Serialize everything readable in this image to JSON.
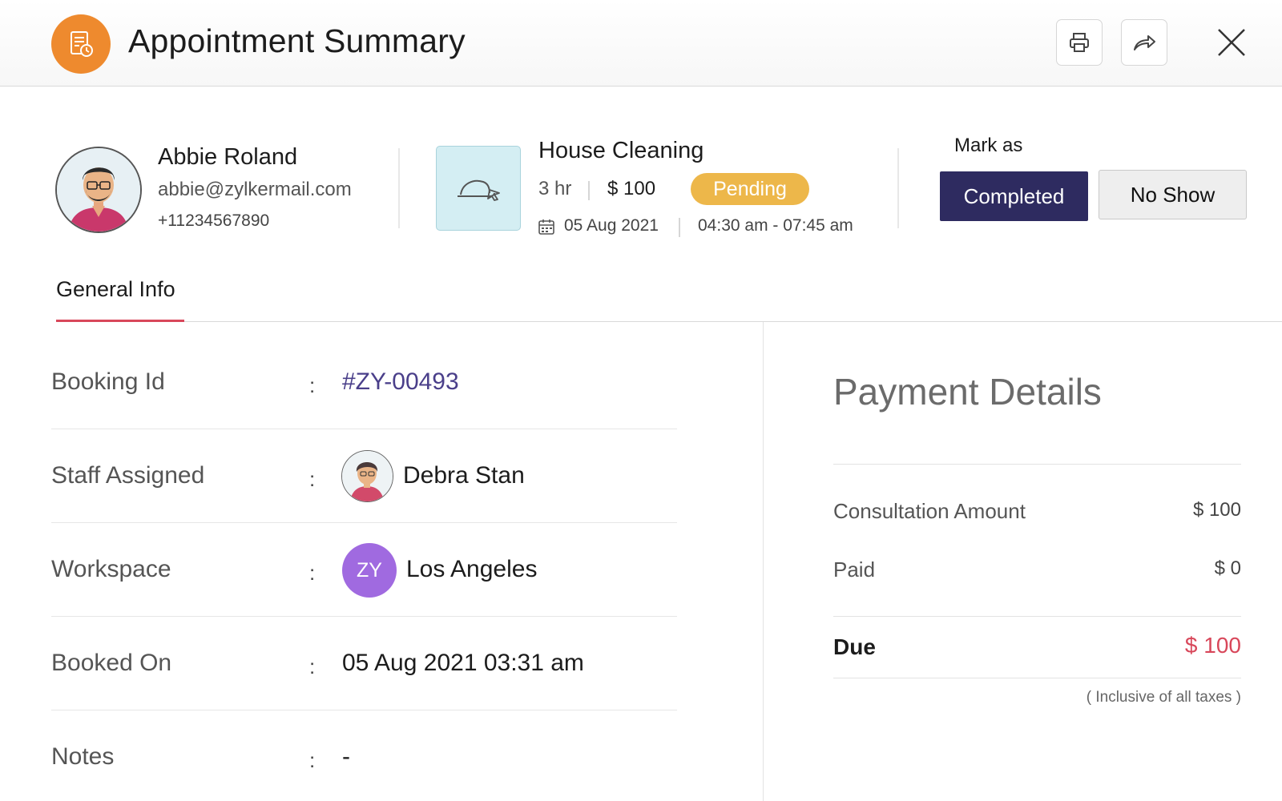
{
  "header": {
    "title": "Appointment Summary",
    "badge_icon": "document-clock-icon",
    "print_icon": "printer-icon",
    "share_icon": "share-arrow-icon",
    "close_icon": "close-icon",
    "badge_color": "#ee8a2e"
  },
  "customer": {
    "name": "Abbie Roland",
    "email": "abbie@zylkermail.com",
    "phone": "+11234567890"
  },
  "service": {
    "name": "House Cleaning",
    "duration": "3 hr",
    "price": "$ 100",
    "status": "Pending",
    "date": "05 Aug 2021",
    "time": "04:30 am - 07:45 am",
    "icon": "cleaning-cap-icon",
    "status_color": "#edb74a"
  },
  "mark_as": {
    "label": "Mark as",
    "completed_label": "Completed",
    "no_show_label": "No Show",
    "completed_color": "#2e2b60"
  },
  "tabs": [
    {
      "label": "General Info",
      "active": true
    }
  ],
  "general_info": {
    "booking_id": {
      "label": "Booking Id",
      "value": "#ZY-00493"
    },
    "staff": {
      "label": "Staff Assigned",
      "value": "Debra Stan"
    },
    "workspace": {
      "label": "Workspace",
      "value": "Los Angeles",
      "initials": "ZY"
    },
    "booked_on": {
      "label": "Booked On",
      "value": "05 Aug 2021 03:31 am"
    },
    "notes": {
      "label": "Notes",
      "value": "-"
    },
    "colon": ":"
  },
  "payment": {
    "title": "Payment Details",
    "consultation_label": "Consultation Amount",
    "consultation_amount": "$ 100",
    "paid_label": "Paid",
    "paid_amount": "$ 0",
    "due_label": "Due",
    "due_amount": "$ 100",
    "tax_note": "( Inclusive of all taxes )",
    "due_color": "#d8475a"
  }
}
